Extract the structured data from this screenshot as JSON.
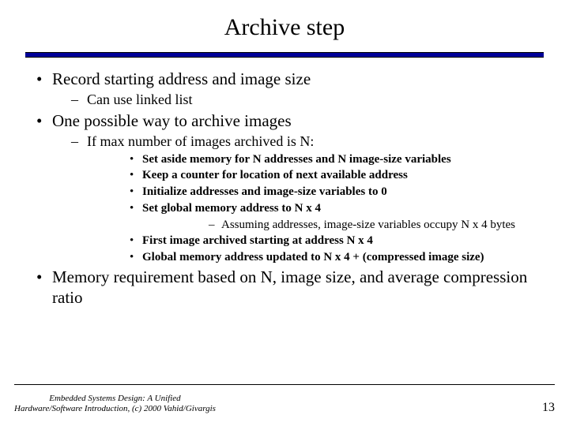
{
  "title": "Archive step",
  "bullets": {
    "i0": "Record starting address and image size",
    "i0_0": "Can use linked list",
    "i1": "One possible way to archive images",
    "i1_0": "If max number of images archived is N:",
    "i1_0_0": "Set aside memory for N addresses and N image-size variables",
    "i1_0_1": "Keep a counter for location of next available address",
    "i1_0_2": "Initialize addresses and image-size variables to 0",
    "i1_0_3": "Set global memory address to N x 4",
    "i1_0_3_0": "Assuming addresses, image-size variables occupy N x 4 bytes",
    "i1_0_4": "First image archived starting at address N x 4",
    "i1_0_5": "Global memory address updated to N x 4 + (compressed image size)",
    "i2": "Memory requirement based on N, image size, and average compression ratio"
  },
  "footer": {
    "left_line1": "Embedded Systems Design: A Unified",
    "left_line2": "Hardware/Software Introduction, (c) 2000 Vahid/Givargis",
    "page": "13"
  }
}
